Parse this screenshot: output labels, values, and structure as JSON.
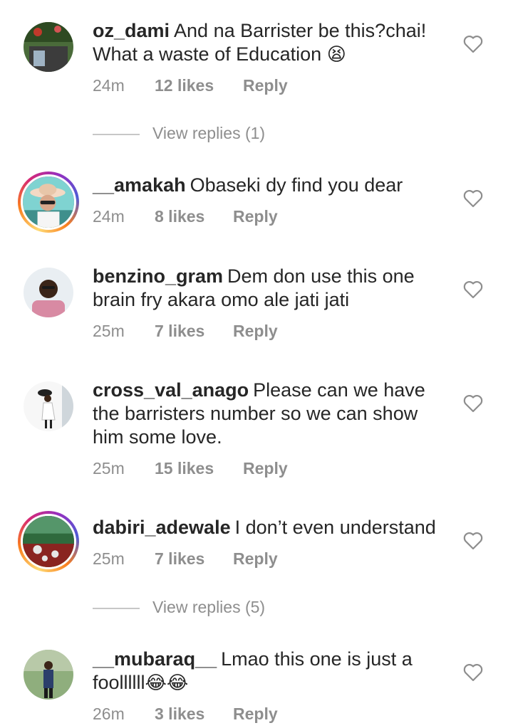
{
  "comments": [
    {
      "username": "oz_dami",
      "text": "And na Barrister be this?chai! What a waste of Education",
      "emoji": "😫",
      "time": "24m",
      "likes": "12 likes",
      "reply": "Reply"
    },
    {
      "username": "__amakah",
      "text": "Obaseki dy find you dear",
      "emoji": "",
      "time": "24m",
      "likes": "8 likes",
      "reply": "Reply"
    },
    {
      "username": "benzino_gram",
      "text": "Dem don use this one brain fry akara omo ale jati jati",
      "emoji": "",
      "time": "25m",
      "likes": "7 likes",
      "reply": "Reply"
    },
    {
      "username": "cross_val_anago",
      "text": "Please can we have the barristers number so we can show him some love.",
      "emoji": "",
      "time": "25m",
      "likes": "15 likes",
      "reply": "Reply"
    },
    {
      "username": "dabiri_adewale",
      "text": "I don’t even understand",
      "emoji": "",
      "time": "25m",
      "likes": "7 likes",
      "reply": "Reply"
    },
    {
      "username": "__mubaraq__",
      "text": "Lmao this one is just a foollllll",
      "emoji": "😂😂",
      "time": "26m",
      "likes": "3 likes",
      "reply": "Reply"
    }
  ],
  "view_replies": [
    "View replies (1)",
    "View replies (5)"
  ],
  "icons": {
    "like": "heart-icon"
  },
  "colors": {
    "text": "#262626",
    "meta": "#8e8e8e"
  }
}
